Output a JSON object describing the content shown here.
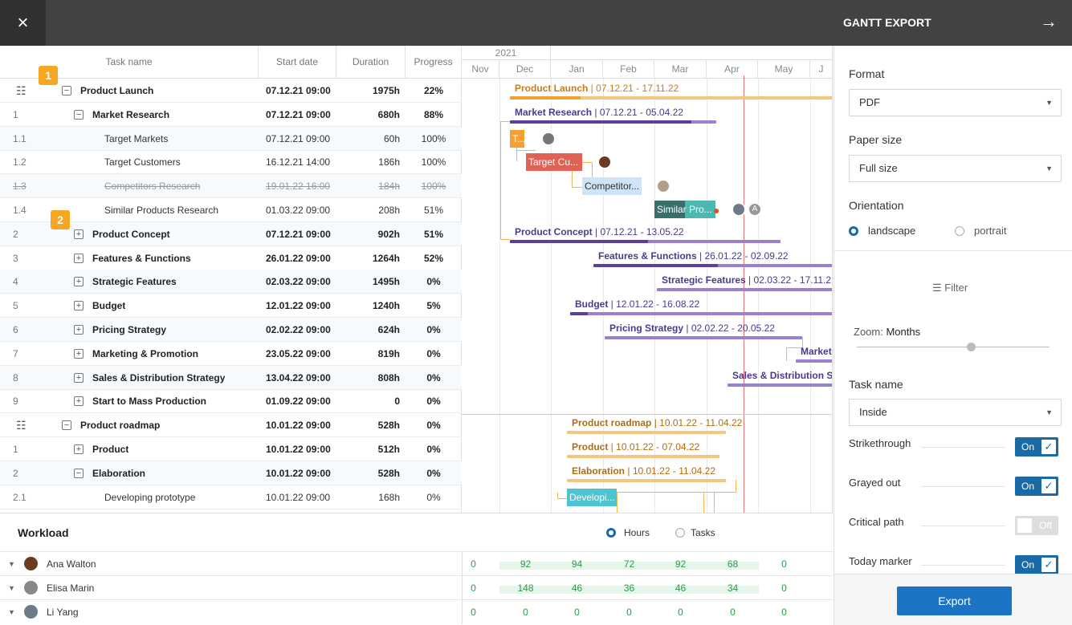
{
  "topbar": {
    "close_icon": "×",
    "title": "GANTT EXPORT",
    "arrow_icon": "→"
  },
  "grid": {
    "headers": {
      "name": "Task name",
      "start": "Start date",
      "duration": "Duration",
      "progress": "Progress"
    },
    "badges": [
      "1",
      "2"
    ],
    "rows": [
      {
        "num": "",
        "name": "Product Launch",
        "start": "07.12.21 09:00",
        "duration": "1975h",
        "progress": "22%"
      },
      {
        "num": "1",
        "name": "Market Research",
        "start": "07.12.21 09:00",
        "duration": "680h",
        "progress": "88%"
      },
      {
        "num": "1.1",
        "name": "Target Markets",
        "start": "07.12.21 09:00",
        "duration": "60h",
        "progress": "100%"
      },
      {
        "num": "1.2",
        "name": "Target Customers",
        "start": "16.12.21 14:00",
        "duration": "186h",
        "progress": "100%"
      },
      {
        "num": "1.3",
        "name": "Competitors Research",
        "start": "19.01.22 16:00",
        "duration": "184h",
        "progress": "100%"
      },
      {
        "num": "1.4",
        "name": "Similar Products Research",
        "start": "01.03.22 09:00",
        "duration": "208h",
        "progress": "51%"
      },
      {
        "num": "2",
        "name": "Product Concept",
        "start": "07.12.21 09:00",
        "duration": "902h",
        "progress": "51%"
      },
      {
        "num": "3",
        "name": "Features & Functions",
        "start": "26.01.22 09:00",
        "duration": "1264h",
        "progress": "52%"
      },
      {
        "num": "4",
        "name": "Strategic Features",
        "start": "02.03.22 09:00",
        "duration": "1495h",
        "progress": "0%"
      },
      {
        "num": "5",
        "name": "Budget",
        "start": "12.01.22 09:00",
        "duration": "1240h",
        "progress": "5%"
      },
      {
        "num": "6",
        "name": "Pricing Strategy",
        "start": "02.02.22 09:00",
        "duration": "624h",
        "progress": "0%"
      },
      {
        "num": "7",
        "name": "Marketing & Promotion",
        "start": "23.05.22 09:00",
        "duration": "819h",
        "progress": "0%"
      },
      {
        "num": "8",
        "name": "Sales & Distribution Strategy",
        "start": "13.04.22 09:00",
        "duration": "808h",
        "progress": "0%"
      },
      {
        "num": "9",
        "name": "Start to Mass Production",
        "start": "01.09.22 09:00",
        "duration": "0",
        "progress": "0%"
      },
      {
        "num": "",
        "name": "Product roadmap",
        "start": "10.01.22 09:00",
        "duration": "528h",
        "progress": "0%"
      },
      {
        "num": "1",
        "name": "Product",
        "start": "10.01.22 09:00",
        "duration": "512h",
        "progress": "0%"
      },
      {
        "num": "2",
        "name": "Elaboration",
        "start": "10.01.22 09:00",
        "duration": "528h",
        "progress": "0%"
      },
      {
        "num": "2.1",
        "name": "Developing prototype",
        "start": "10.01.22 09:00",
        "duration": "168h",
        "progress": "0%"
      }
    ]
  },
  "timeline": {
    "year": "2021",
    "months": [
      "Nov",
      "Dec",
      "Jan",
      "Feb",
      "Mar",
      "Apr",
      "May",
      "J"
    ],
    "labels": {
      "pl": "Product Launch",
      "pl_d": "07.12.21 - 17.11.22",
      "mr": "Market Research",
      "mr_d": "07.12.21 - 05.04.22",
      "t": "T...",
      "tc": "Target Cu...",
      "cr": "Competitor...",
      "sp": "Similar Pro...",
      "avatar_a": "A",
      "pc": "Product Concept",
      "pc_d": "07.12.21 - 13.05.22",
      "ff": "Features & Functions",
      "ff_d": "26.01.22 - 02.09.22",
      "sf": "Strategic Features",
      "sf_d": "02.03.22 - 17.11.2",
      "bu": "Budget",
      "bu_d": "12.01.22 - 16.08.22",
      "ps": "Pricing Strategy",
      "ps_d": "02.02.22 - 20.05.22",
      "mp": "Market",
      "sd": "Sales & Distribution S",
      "pr": "Product roadmap",
      "pr_d": "10.01.22 - 11.04.22",
      "p": "Product",
      "p_d": "10.01.22 - 07.04.22",
      "el": "Elaboration",
      "el_d": "10.01.22 - 11.04.22",
      "dp": "Developi..."
    }
  },
  "workload": {
    "title": "Workload",
    "hours_label": "Hours",
    "tasks_label": "Tasks",
    "people": [
      {
        "name": "Ana Walton",
        "values": [
          "0",
          "92",
          "94",
          "72",
          "92",
          "68",
          "0"
        ]
      },
      {
        "name": "Elisa Marin",
        "values": [
          "0",
          "148",
          "46",
          "36",
          "46",
          "34",
          "0"
        ]
      },
      {
        "name": "Li Yang",
        "values": [
          "0",
          "0",
          "0",
          "0",
          "0",
          "0",
          "0"
        ]
      }
    ]
  },
  "panel": {
    "format_label": "Format",
    "format_value": "PDF",
    "paper_label": "Paper size",
    "paper_value": "Full size",
    "orientation_label": "Orientation",
    "landscape": "landscape",
    "portrait": "portrait",
    "filter": "Filter",
    "zoom_label": "Zoom:",
    "zoom_value": "Months",
    "taskname_label": "Task name",
    "taskname_value": "Inside",
    "strike": "Strikethrough",
    "grayed": "Grayed out",
    "critical": "Critical path",
    "today": "Today marker",
    "on": "On",
    "off": "Off",
    "export": "Export"
  }
}
